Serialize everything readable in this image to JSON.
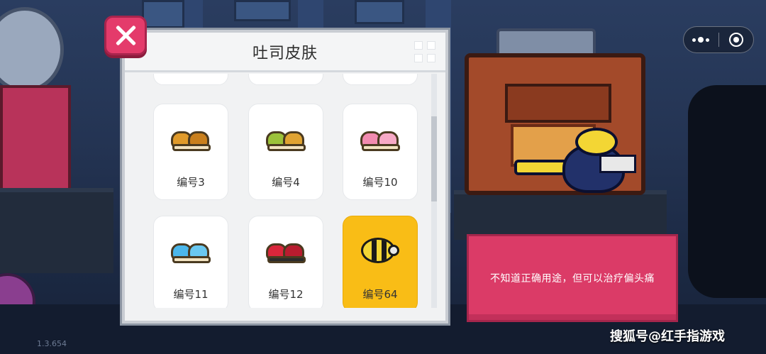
{
  "dialog": {
    "title": "吐司皮肤",
    "close_label": "",
    "skins": [
      {
        "label": "编号3",
        "icon": "toast-orange-icon",
        "color": "#e09a2a",
        "selected": false
      },
      {
        "label": "编号4",
        "icon": "toast-green-icon",
        "color": "#9cc23a",
        "selected": false
      },
      {
        "label": "编号10",
        "icon": "toast-pink-icon",
        "color": "#f28bb0",
        "selected": false
      },
      {
        "label": "编号11",
        "icon": "toast-blue-icon",
        "color": "#4cb7ea",
        "selected": false
      },
      {
        "label": "编号12",
        "icon": "toast-red-icon",
        "color": "#d9263b",
        "selected": false
      },
      {
        "label": "编号64",
        "icon": "bee-toast-icon",
        "color": "#f3d634",
        "selected": true
      }
    ]
  },
  "description": {
    "text": "不知道正确用途，但可以治疗偏头痛"
  },
  "version": "1.3.654",
  "watermark": "搜狐号@红手指游戏",
  "colors": {
    "selected_card": "#f9bd16",
    "close_button": "#e43b6b",
    "description_panel": "#db3b67"
  }
}
